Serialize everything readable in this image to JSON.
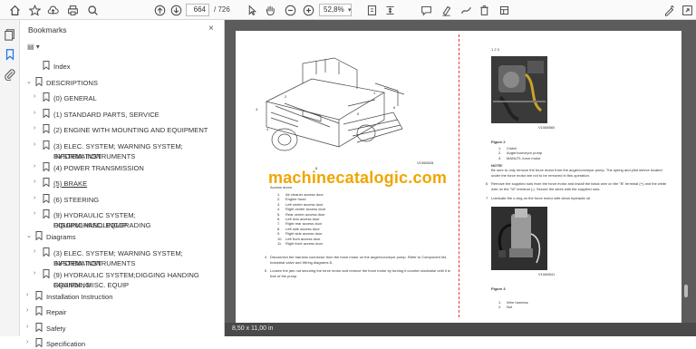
{
  "toolbar": {
    "page_current": "664",
    "page_total": "/ 726",
    "zoom": "52,8%",
    "icons": [
      "home-icon",
      "star-icon",
      "upload-icon",
      "print-icon",
      "search-icon",
      "arrow-up-icon",
      "arrow-down-icon",
      "cursor-icon",
      "hand-icon",
      "zoom-out-icon",
      "zoom-in-icon",
      "fit-page-icon",
      "scroll-mode-icon",
      "comment-icon",
      "highlight-icon",
      "draw-icon",
      "erase-icon",
      "more-tools-icon",
      "sign-icon",
      "share-icon"
    ]
  },
  "sidebar": {
    "title": "Bookmarks",
    "close": "×",
    "options": "▤ ▾",
    "items": [
      {
        "label": "Index",
        "level": 1,
        "expandable": false
      },
      {
        "label": "DESCRIPTIONS",
        "level": 0,
        "expandable": true,
        "expanded": true
      },
      {
        "label": "(0) GENERAL",
        "level": 1,
        "expandable": true
      },
      {
        "label": "(1) STANDARD PARTS, SERVICE",
        "level": 1,
        "expandable": true
      },
      {
        "label": "(2) ENGINE WITH MOUNTING AND EQUIPMENT",
        "level": 1,
        "expandable": true
      },
      {
        "label": "(3) ELEC. SYSTEM; WARNING SYSTEM; INFORMATION",
        "label2": "SYSTEM; INSTRUMENTS",
        "level": 1,
        "expandable": true
      },
      {
        "label": "(4) POWER TRANSMISSION",
        "level": 1,
        "expandable": true
      },
      {
        "label": "(5) BRAKE",
        "level": 1,
        "expandable": true,
        "underline": true
      },
      {
        "label": "(6) STEERING",
        "level": 1,
        "expandable": true
      },
      {
        "label": "(9) HYDRAULIC SYSTEM; DIGGINGHANDLINGGRADING",
        "label2": "EQUIPM; MISC. EQUIP",
        "level": 1,
        "expandable": true
      },
      {
        "label": "Diagrams",
        "level": 0,
        "expandable": true,
        "expanded": true
      },
      {
        "label": "(3) ELEC. SYSTEM; WARNING SYSTEM; INFORMATION",
        "label2": "SYSTEM; INSTRUMENTS",
        "level": 1,
        "expandable": true
      },
      {
        "label": "(9) HYDRAULIC SYSTEM;DIGGING HANDING GRANDING",
        "label2": "EQUIPM.; MISC. EQUIP",
        "level": 1,
        "expandable": true
      },
      {
        "label": "Installation Instruction",
        "level": 0,
        "expandable": true
      },
      {
        "label": "Repair",
        "level": 0,
        "expandable": true
      },
      {
        "label": "Safety",
        "level": 0,
        "expandable": true
      },
      {
        "label": "Specification",
        "level": 0,
        "expandable": true
      }
    ]
  },
  "document": {
    "page_size": "8,50 x 11,00 in",
    "watermark": "machinecatalogic.com",
    "left_page": {
      "fig_code": "V1068528",
      "fig_num": "8",
      "callout": "Access doors",
      "list": [
        "Air cleaner access door",
        "Engine hood",
        "Left center access door",
        "Right center access door",
        "Rear center access door",
        "Left rear access door",
        "Right rear access door",
        "Left side access door",
        "Right side access door",
        "Left front access door",
        "Right front access door"
      ],
      "step4": "Disconnect the harness connector from the force motor on the auger/conveyor pump. Refer to Component list, Industrial valve and Wiring diagrams 8.",
      "step5": "Loosen the jam nut securing the force motor and remove the force motor by turning it counter-clockwise until it is free of the pump."
    },
    "right_page": {
      "top_callouts": "1    2         3",
      "fig1_code": "V1068560",
      "figure2": "Figure 2",
      "fig2_list": [
        "Clutch",
        "Auger/conveyor pump",
        "MANUTL force motor"
      ],
      "note_label": "NOTE!",
      "note": "Be sure to only remove the force motor from the auger/conveyor pump. The spring and pilot sleeve located under the force motor are not to be removed in this operation.",
      "step6": "Remove the supplied nuts from the force motor and install the black wire on the \"B\" terminal (+) and the white wire on the \"W\" terminal (-). Secure the wires with the supplied nuts.",
      "step7": "Lubricate the o-ring on the force motor with clean hydraulic oil.",
      "figure3": "Figure 3",
      "fig3_list": [
        "Wire harness",
        "Nut"
      ],
      "fig2_code": "V1068541"
    }
  }
}
